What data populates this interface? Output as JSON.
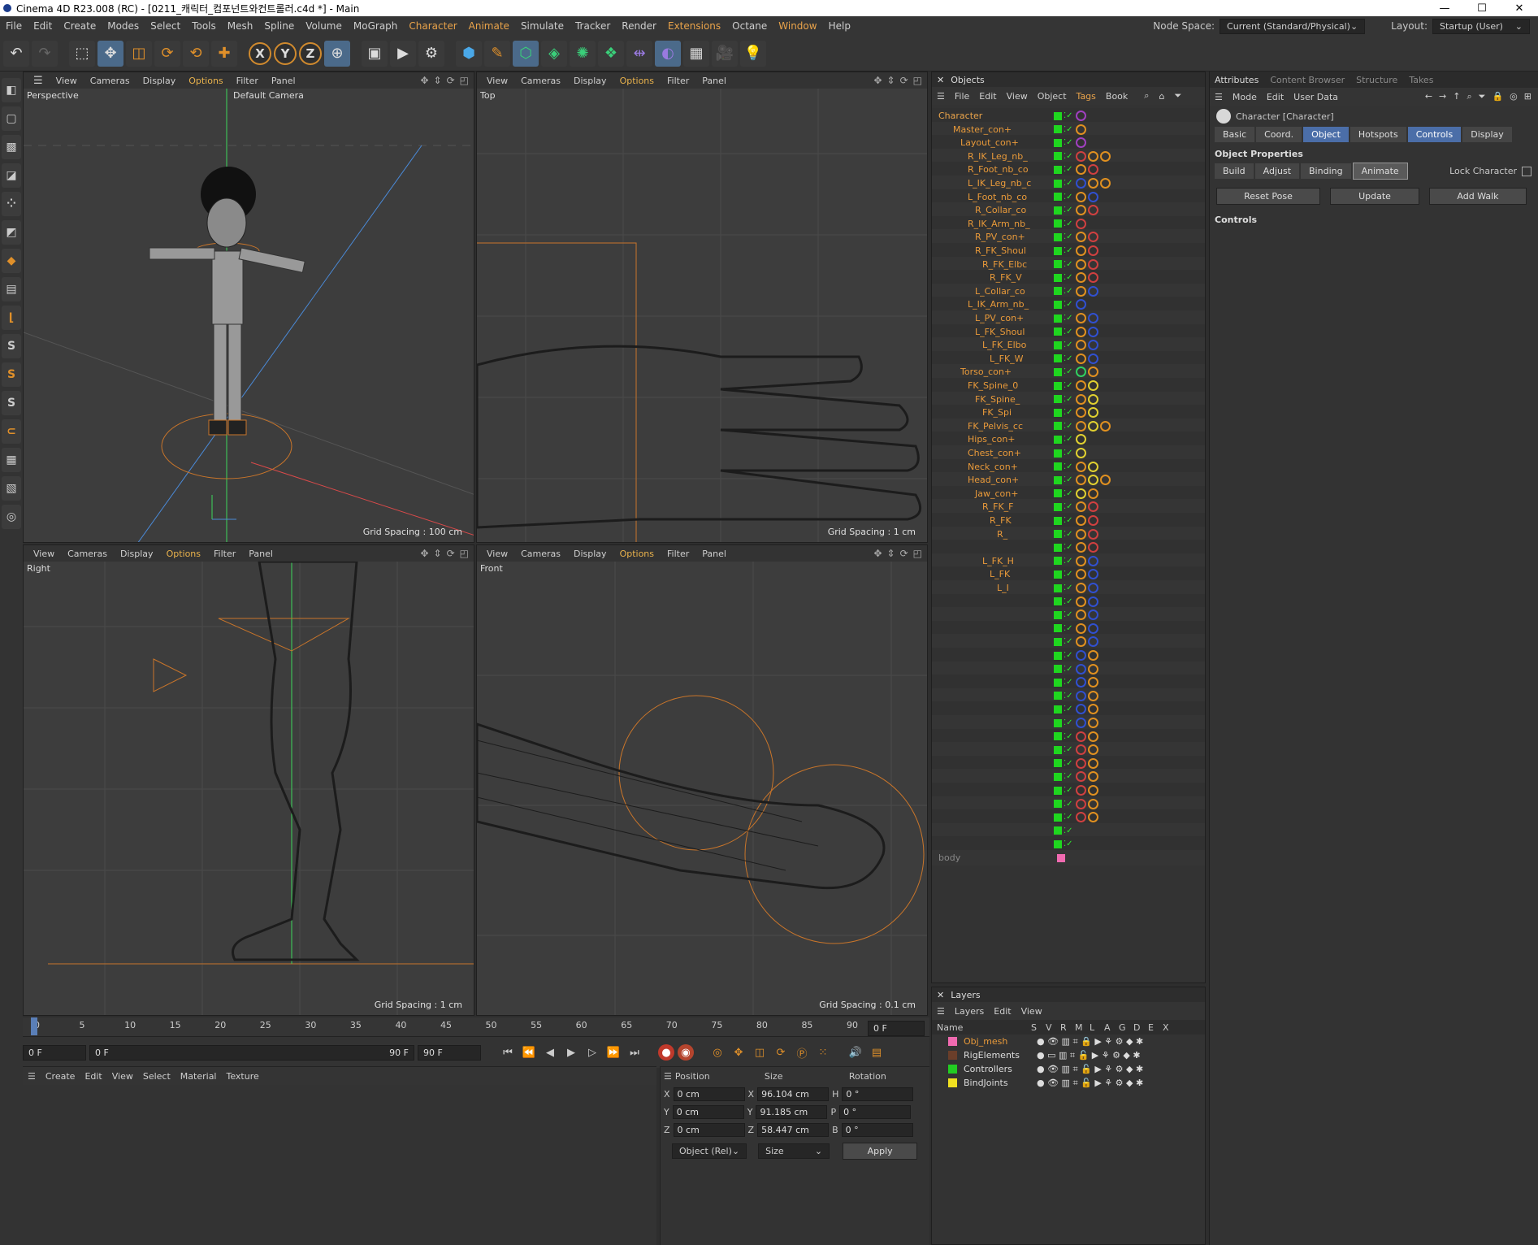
{
  "window": {
    "title": "Cinema 4D R23.008 (RC) - [0211_캐릭터_컴포넌트와컨트롤러.c4d *] - Main",
    "controls": [
      "—",
      "☐",
      "✕"
    ]
  },
  "menubar": {
    "items": [
      "File",
      "Edit",
      "Create",
      "Modes",
      "Select",
      "Tools",
      "Mesh",
      "Spline",
      "Volume",
      "MoGraph",
      "Character",
      "Animate",
      "Simulate",
      "Tracker",
      "Render",
      "Extensions",
      "Octane",
      "Window",
      "Help"
    ],
    "node_space_label": "Node Space:",
    "node_space_value": "Current (Standard/Physical)",
    "layout_label": "Layout:",
    "layout_value": "Startup (User)"
  },
  "viewport_menu": [
    "View",
    "Cameras",
    "Display",
    "Options",
    "Filter",
    "Panel"
  ],
  "viewports": [
    {
      "name": "Perspective",
      "camera": "Default Camera",
      "grid": "Grid Spacing : 100 cm"
    },
    {
      "name": "Top",
      "grid": "Grid Spacing : 1 cm"
    },
    {
      "name": "Right",
      "grid": "Grid Spacing : 1 cm"
    },
    {
      "name": "Front",
      "grid": "Grid Spacing : 0.1 cm"
    }
  ],
  "objects": {
    "title": "Objects",
    "menu": [
      "File",
      "Edit",
      "View",
      "Object",
      "Tags",
      "Book"
    ],
    "rows": [
      "Character",
      "Master_con+",
      "Layout_con+",
      "R_IK_Leg_nb_",
      "R_Foot_nb_co",
      "L_IK_Leg_nb_c",
      "L_Foot_nb_co",
      "R_Collar_co",
      "R_IK_Arm_nb_",
      "R_PV_con+",
      "R_FK_Shoul",
      "R_FK_Elbc",
      "R_FK_V",
      "L_Collar_co",
      "L_IK_Arm_nb_",
      "L_PV_con+",
      "L_FK_Shoul",
      "L_FK_Elbo",
      "L_FK_W",
      "Torso_con+",
      "FK_Spine_0",
      "FK_Spine_",
      "FK_Spi",
      "FK_Pelvis_cc",
      "Hips_con+",
      "Chest_con+",
      "Neck_con+",
      "Head_con+",
      "Jaw_con+",
      "R_FK_F",
      "R_FK",
      "R_",
      "",
      "L_FK_H",
      "L_FK",
      "L_I",
      "",
      "",
      "",
      "",
      "",
      "",
      "",
      "",
      "",
      "",
      "",
      "",
      "",
      "",
      "",
      "",
      "",
      "",
      "",
      "body"
    ]
  },
  "layers": {
    "title": "Layers",
    "menu": [
      "Layers",
      "Edit",
      "View"
    ],
    "columns": [
      "Name",
      "S",
      "V",
      "R",
      "M",
      "L",
      "A",
      "G",
      "D",
      "E",
      "X"
    ],
    "rows": [
      {
        "name": "Obj_mesh",
        "color": "#f06ab0"
      },
      {
        "name": "RigElements",
        "color": "#6a3e2a"
      },
      {
        "name": "Controllers",
        "color": "#22cc22"
      },
      {
        "name": "BindJoints",
        "color": "#f0e020"
      }
    ]
  },
  "attributes": {
    "tabs": [
      "Attributes",
      "Content Browser",
      "Structure",
      "Takes"
    ],
    "menu": [
      "Mode",
      "Edit",
      "User Data"
    ],
    "object_label": "Character [Character]",
    "subtabs": [
      "Basic",
      "Coord.",
      "Object",
      "Hotspots",
      "Controls",
      "Display"
    ],
    "section": "Object Properties",
    "modes": [
      "Build",
      "Adjust",
      "Binding",
      "Animate"
    ],
    "lock": "Lock Character",
    "buttons": [
      "Reset Pose",
      "Update",
      "Add Walk"
    ],
    "controls": "Controls"
  },
  "timeline": {
    "ticks": [
      "0",
      "5",
      "10",
      "15",
      "20",
      "25",
      "30",
      "35",
      "40",
      "45",
      "50",
      "55",
      "60",
      "65",
      "70",
      "75",
      "80",
      "85",
      "90"
    ],
    "current": "0 F",
    "start": "0 F",
    "range_start": "0 F",
    "range_end": "90 F",
    "end": "90 F"
  },
  "material": {
    "menu": [
      "Create",
      "Edit",
      "View",
      "Select",
      "Material",
      "Texture"
    ]
  },
  "coords": {
    "headers": [
      "Position",
      "Size",
      "Rotation"
    ],
    "rows": [
      {
        "axis": "X",
        "pos": "0 cm",
        "sizeaxis": "X",
        "size": "96.104 cm",
        "rotaxis": "H",
        "rot": "0 °"
      },
      {
        "axis": "Y",
        "pos": "0 cm",
        "sizeaxis": "Y",
        "size": "91.185 cm",
        "rotaxis": "P",
        "rot": "0 °"
      },
      {
        "axis": "Z",
        "pos": "0 cm",
        "sizeaxis": "Z",
        "size": "58.447 cm",
        "rotaxis": "B",
        "rot": "0 °"
      }
    ],
    "mode": "Object (Rel)",
    "size_mode": "Size",
    "apply": "Apply"
  }
}
